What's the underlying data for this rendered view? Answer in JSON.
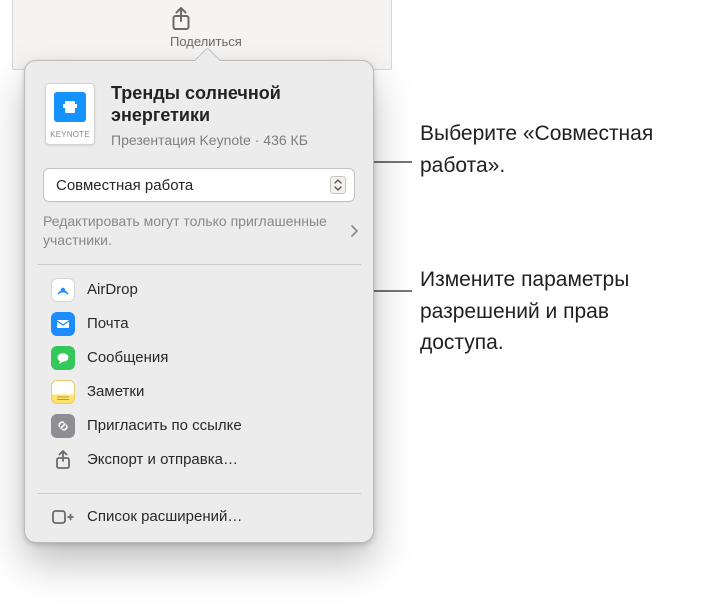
{
  "toolbar": {
    "share_label": "Поделиться"
  },
  "doc": {
    "icon_badge": "KEYNOTE",
    "title": "Тренды солнечной энергетики",
    "meta_type": "Презентация Keynote",
    "meta_sep": " · ",
    "meta_size": "436 КБ"
  },
  "mode": {
    "selected": "Совместная работа"
  },
  "permissions": {
    "text": "Редактировать могут только приглашенные участники."
  },
  "share_targets": [
    {
      "id": "airdrop",
      "label": "AirDrop"
    },
    {
      "id": "mail",
      "label": "Почта"
    },
    {
      "id": "messages",
      "label": "Сообщения"
    },
    {
      "id": "notes",
      "label": "Заметки"
    },
    {
      "id": "link",
      "label": "Пригласить по ссылке"
    },
    {
      "id": "export",
      "label": "Экспорт и отправка…"
    }
  ],
  "extensions": {
    "label": "Список расширений…"
  },
  "annotations": {
    "a1": "Выберите «Совместная работа».",
    "a2": "Измените параметры разрешений и прав доступа."
  }
}
